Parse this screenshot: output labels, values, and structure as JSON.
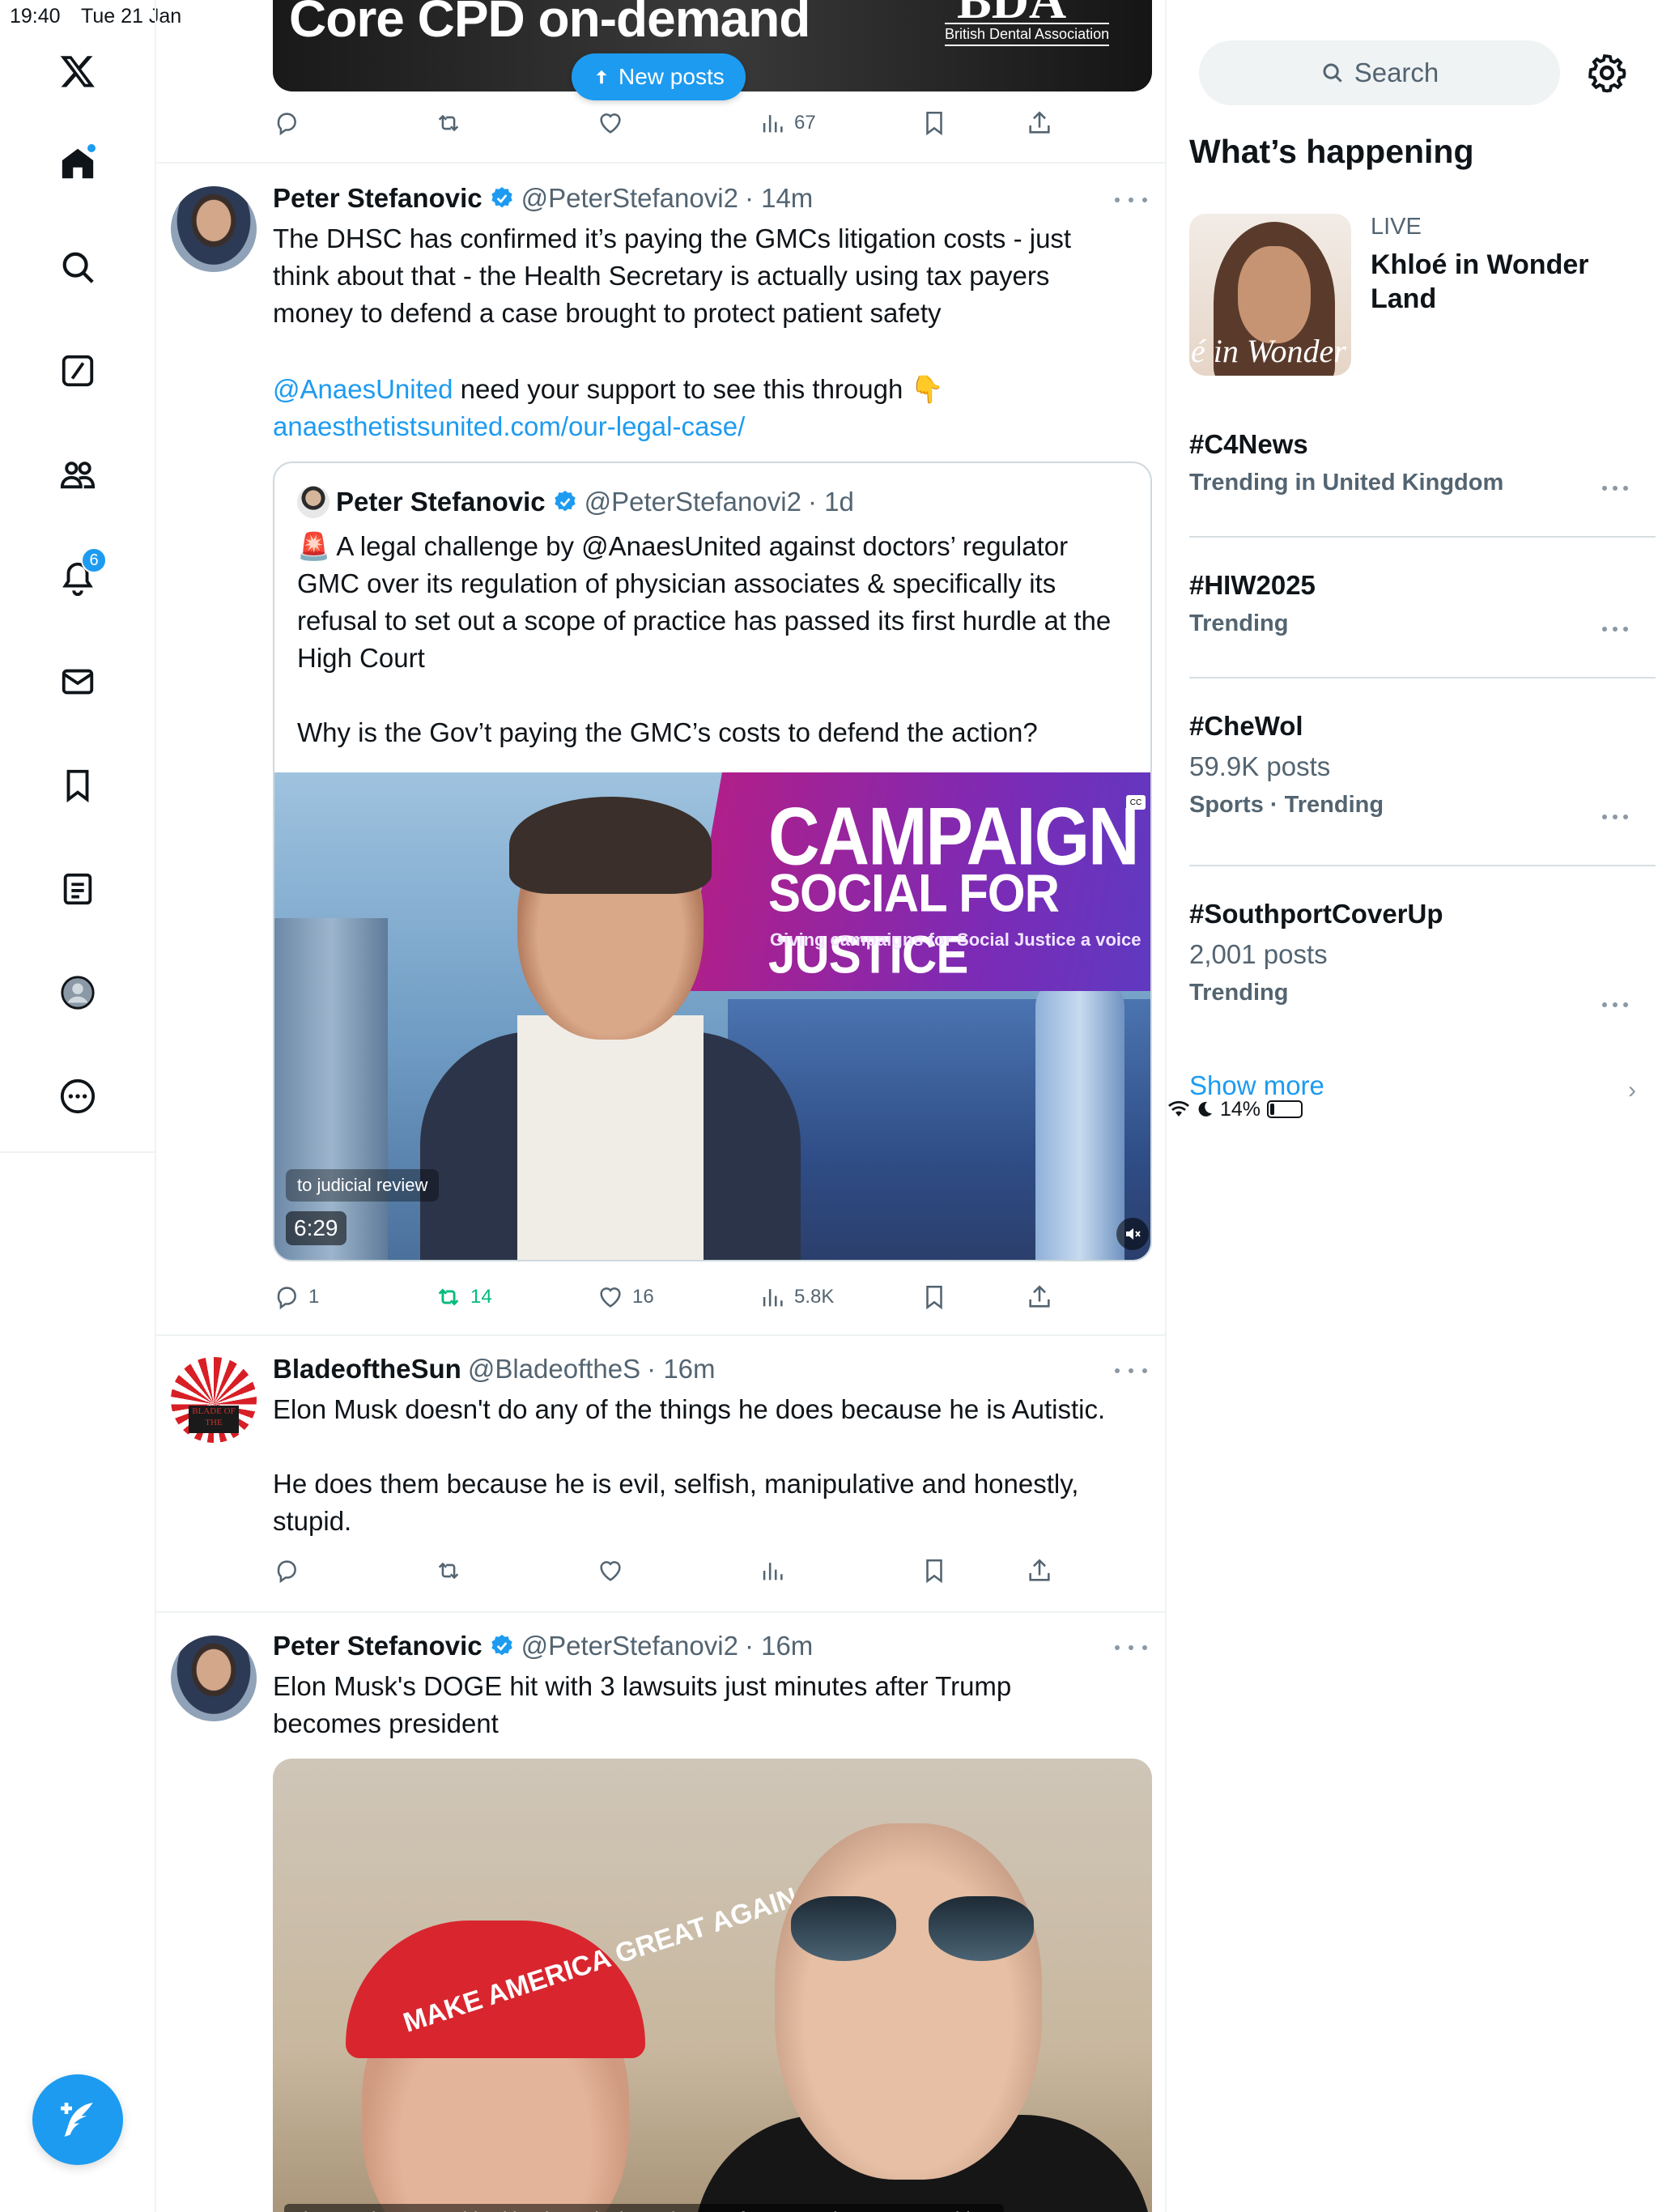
{
  "status_bar": {
    "time": "19:40",
    "date": "Tue 21 Jan",
    "battery": "14%",
    "battery_level": 0.14
  },
  "nav": {
    "items": [
      {
        "name": "home",
        "icon": "home-icon"
      },
      {
        "name": "explore",
        "icon": "search-icon"
      },
      {
        "name": "grok",
        "icon": "grok-icon"
      },
      {
        "name": "communities",
        "icon": "communities-icon"
      },
      {
        "name": "notifications",
        "icon": "bell-icon",
        "badge": "6"
      },
      {
        "name": "messages",
        "icon": "mail-icon"
      },
      {
        "name": "bookmarks",
        "icon": "bookmark-icon"
      },
      {
        "name": "lists",
        "icon": "list-icon"
      },
      {
        "name": "profile",
        "icon": "profile-icon"
      },
      {
        "name": "more",
        "icon": "more-circle-icon"
      }
    ],
    "compose_icon": "compose-feather-icon",
    "accent": "#1d9bf0"
  },
  "feed": {
    "top_media": {
      "headline": "Core CPD on-demand",
      "brand_big": "BDA",
      "brand_small": "British Dental Association"
    },
    "new_posts_label": "New posts",
    "top_actions": {
      "views": "67"
    },
    "posts": [
      {
        "name": "Peter Stefanovic",
        "handle": "@PeterStefanovi2",
        "time": "· 14m",
        "text": "The DHSC has confirmed it’s paying the GMCs litigation costs - just think about that - the Health Secretary is actually using tax payers money to defend a case brought to protect patient safety",
        "mention": "@AnaesUnited",
        "text2": " need your support to see this through 👇",
        "link": "anaesthetistsunited.com/our-legal-case/",
        "quote": {
          "name": "Peter Stefanovic",
          "handle": "@PeterStefanovi2",
          "time": "· 1d",
          "text": "🚨 A legal challenge by @AnaesUnited against doctors’ regulator GMC over its regulation of physician associates & specifically its refusal to set out a scope of practice has passed its first hurdle at the High Court\n\nWhy is the Gov’t paying the GMC’s costs to defend the action?",
          "video": {
            "banner_line1": "CAMPAIGN",
            "banner_line2": "SOCIAL FOR JUSTICE",
            "banner_line3": "Giving campaigns for Social Justice a voice",
            "cc": "CC",
            "caption": "to judicial review",
            "duration": "6:29"
          }
        },
        "replies": "1",
        "reposts": "14",
        "likes": "16",
        "views": "5.8K"
      },
      {
        "name": "BladeoftheSun",
        "handle": "@BladeoftheS",
        "time": "· 16m",
        "avatar_text": "BLADE OF THE",
        "text": "Elon Musk doesn't do any of the things he does because he is Autistic.\n\nHe does them because he is evil, selfish, manipulative and honestly, stupid."
      },
      {
        "name": "Peter Stefanovic",
        "handle": "@PeterStefanovi2",
        "time": "· 16m",
        "text": "Elon Musk's DOGE hit with 3 lawsuits just minutes after Trump becomes president",
        "image_cap_text": "MAKE AMERICA GREAT AGAIN",
        "image_alt": "Elon Musk's DOGE hit with 3 lawsuits just minutes after Trump becomes president"
      }
    ]
  },
  "sidebar": {
    "search_placeholder": "Search",
    "section_title": "What’s happening",
    "feature": {
      "live": "LIVE",
      "title": "Khloé in Wonder Land",
      "image_text": "é in Wonder L"
    },
    "trends": [
      {
        "title": "#C4News",
        "meta": "Trending in United Kingdom"
      },
      {
        "title": "#HIW2025",
        "meta": "Trending"
      },
      {
        "title": "#CheWol",
        "count": "59.9K posts",
        "meta": "Sports · Trending"
      },
      {
        "title": "#SouthportCoverUp",
        "count": "2,001 posts",
        "meta": "Trending"
      }
    ],
    "show_more": "Show more"
  }
}
